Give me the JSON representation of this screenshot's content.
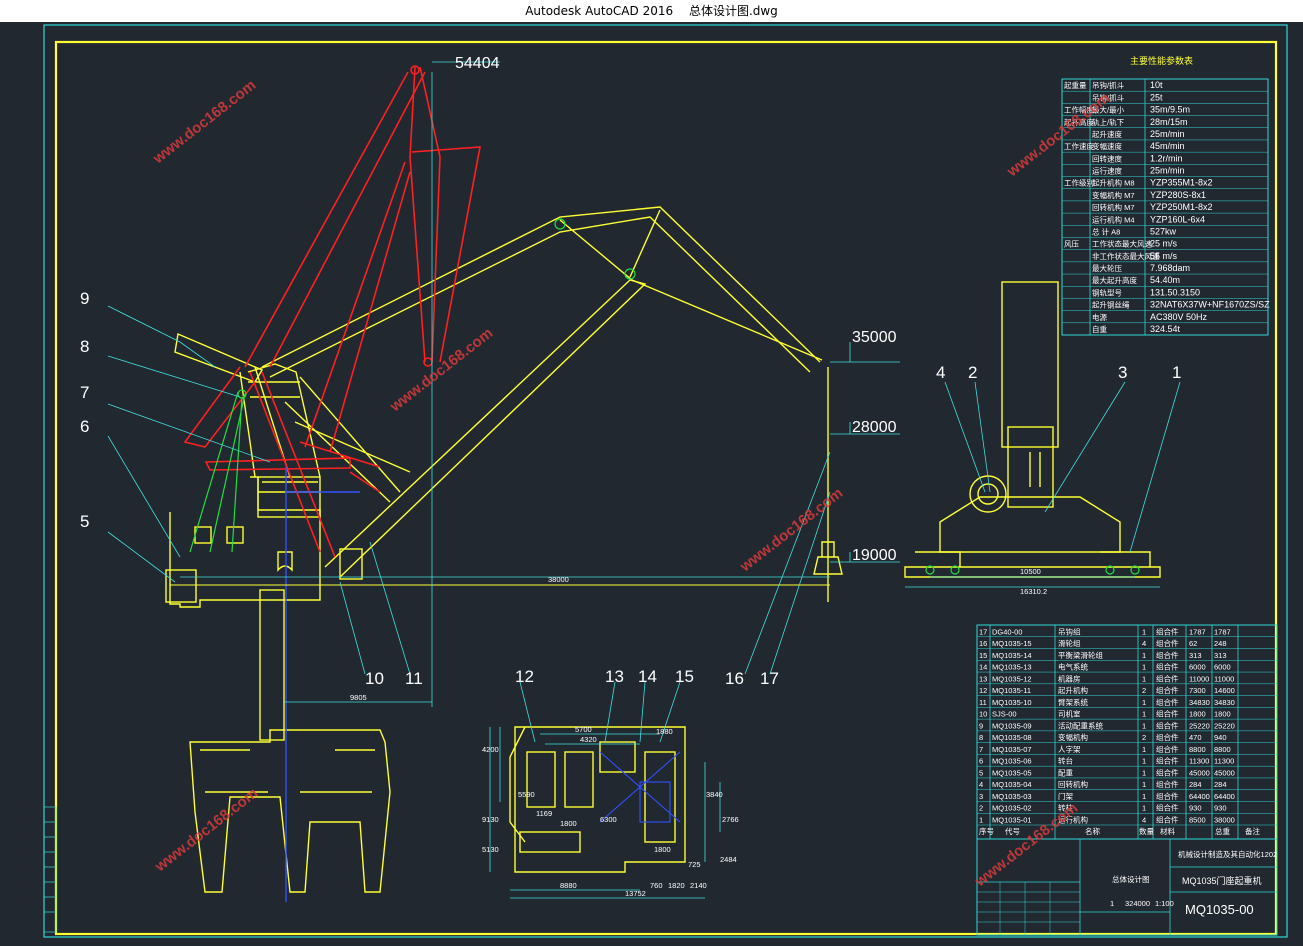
{
  "window": {
    "app": "Autodesk AutoCAD 2016",
    "file": "总体设计图.dwg"
  },
  "elevations": {
    "e1": "54404",
    "e2": "35000",
    "e3": "28000",
    "e4": "19000"
  },
  "part_labels": [
    "9",
    "8",
    "7",
    "6",
    "5",
    "10",
    "11",
    "12",
    "13",
    "14",
    "15",
    "16",
    "17",
    "4",
    "2",
    "3",
    "1"
  ],
  "dims": {
    "rail_span": "38000",
    "base_span": "9805",
    "front_a": "10500",
    "front_b": "16310.2",
    "plan_5700": "5700",
    "plan_4320": "4320",
    "plan_1880": "1880",
    "plan_8880": "8880",
    "plan_13752": "13752",
    "plan_760": "760",
    "plan_1820": "1820",
    "plan_2140": "2140",
    "plan_1800": "1800",
    "plan_1169": "1169",
    "plan_4200": "4200",
    "plan_9130": "9130",
    "plan_5130": "5130",
    "plan_3840": "3840",
    "plan_2766": "2766",
    "plan_2484": "2484",
    "plan_725": "725",
    "plan_5590": "5590",
    "plan_6300": "6300"
  },
  "perf_table": {
    "title": "主要性能参数表",
    "rows": [
      {
        "a": "起重量",
        "b": "吊钩/抓斗",
        "v": "10t"
      },
      {
        "a": "",
        "b": "吊钩/抓斗",
        "v": "25t"
      },
      {
        "a": "工作幅度",
        "b": "最大/最小",
        "v": "35m/9.5m"
      },
      {
        "a": "起升高度",
        "b": "轨上/轨下",
        "v": "28m/15m"
      },
      {
        "a": "",
        "b": "起升速度",
        "v": "25m/min"
      },
      {
        "a": "工作速度",
        "b": "变幅速度",
        "v": "45m/min"
      },
      {
        "a": "",
        "b": "回转速度",
        "v": "1.2r/min"
      },
      {
        "a": "",
        "b": "运行速度",
        "v": "25m/min"
      },
      {
        "a": "工作级别",
        "b": "起升机构 M8",
        "v": "YZP355M1-8x2"
      },
      {
        "a": "",
        "b": "变幅机构 M7",
        "v": "YZP280S-8x1"
      },
      {
        "a": "",
        "b": "回转机构 M7",
        "v": "YZP250M1-8x2"
      },
      {
        "a": "",
        "b": "运行机构 M4",
        "v": "YZP160L-6x4"
      },
      {
        "a": "",
        "b": "总  计 A8",
        "v": "527kw"
      },
      {
        "a": "风压",
        "b": "工作状态最大风速",
        "v": "25 m/s"
      },
      {
        "a": "",
        "b": "非工作状态最大风速",
        "v": "55 m/s"
      },
      {
        "a": "",
        "b": "最大轮压",
        "v": "7.968dam"
      },
      {
        "a": "",
        "b": "最大起升高度",
        "v": "54.40m"
      },
      {
        "a": "",
        "b": "钢轨型号",
        "v": "131.50.3150"
      },
      {
        "a": "",
        "b": "起升钢丝绳",
        "v": "32NAT6X37W+NF1670ZS/SZ"
      },
      {
        "a": "",
        "b": "电源",
        "v": "AC380V  50Hz"
      },
      {
        "a": "",
        "b": "自重",
        "v": "324.54t"
      }
    ]
  },
  "bom": {
    "rows": [
      {
        "no": "17",
        "code": "DG40-00",
        "name": "吊钩组",
        "qty": "1",
        "mat": "组合件",
        "w1": "1787",
        "w2": "1787"
      },
      {
        "no": "16",
        "code": "MQ1035-15",
        "name": "滑轮组",
        "qty": "4",
        "mat": "组合件",
        "w1": "62",
        "w2": "248"
      },
      {
        "no": "15",
        "code": "MQ1035-14",
        "name": "平衡梁滑轮组",
        "qty": "1",
        "mat": "组合件",
        "w1": "313",
        "w2": "313"
      },
      {
        "no": "14",
        "code": "MQ1035-13",
        "name": "电气系统",
        "qty": "1",
        "mat": "组合件",
        "w1": "6000",
        "w2": "6000"
      },
      {
        "no": "13",
        "code": "MQ1035-12",
        "name": "机器房",
        "qty": "1",
        "mat": "组合件",
        "w1": "11000",
        "w2": "11000"
      },
      {
        "no": "12",
        "code": "MQ1035-11",
        "name": "起升机构",
        "qty": "2",
        "mat": "组合件",
        "w1": "7300",
        "w2": "14600"
      },
      {
        "no": "11",
        "code": "MQ1035-10",
        "name": "臂架系统",
        "qty": "1",
        "mat": "组合件",
        "w1": "34830",
        "w2": "34830"
      },
      {
        "no": "10",
        "code": "SJS-00",
        "name": "司机室",
        "qty": "1",
        "mat": "组合件",
        "w1": "1800",
        "w2": "1800"
      },
      {
        "no": "9",
        "code": "MQ1035-09",
        "name": "活动配重系统",
        "qty": "1",
        "mat": "组合件",
        "w1": "25220",
        "w2": "25220"
      },
      {
        "no": "8",
        "code": "MQ1035-08",
        "name": "变幅机构",
        "qty": "2",
        "mat": "组合件",
        "w1": "470",
        "w2": "940"
      },
      {
        "no": "7",
        "code": "MQ1035-07",
        "name": "人字架",
        "qty": "1",
        "mat": "组合件",
        "w1": "8800",
        "w2": "8800"
      },
      {
        "no": "6",
        "code": "MQ1035-06",
        "name": "转台",
        "qty": "1",
        "mat": "组合件",
        "w1": "11300",
        "w2": "11300"
      },
      {
        "no": "5",
        "code": "MQ1035-05",
        "name": "配重",
        "qty": "1",
        "mat": "组合件",
        "w1": "45000",
        "w2": "45000"
      },
      {
        "no": "4",
        "code": "MQ1035-04",
        "name": "回转机构",
        "qty": "1",
        "mat": "组合件",
        "w1": "284",
        "w2": "284"
      },
      {
        "no": "3",
        "code": "MQ1035-03",
        "name": "门架",
        "qty": "1",
        "mat": "组合件",
        "w1": "64400",
        "w2": "64400"
      },
      {
        "no": "2",
        "code": "MQ1035-02",
        "name": "转柱",
        "qty": "1",
        "mat": "组合件",
        "w1": "930",
        "w2": "930"
      },
      {
        "no": "1",
        "code": "MQ1035-01",
        "name": "运行机构",
        "qty": "4",
        "mat": "组合件",
        "w1": "8500",
        "w2": "38000"
      }
    ],
    "header": {
      "no": "序号",
      "code": "代号",
      "name": "名称",
      "qty": "数量",
      "mat": "材料",
      "weight": "总重",
      "note": "备注"
    }
  },
  "title_block": {
    "assembly": "总体设计图",
    "drawing_name": "MQ1035门座起重机",
    "drawing_no": "MQ1035-00",
    "company": "机械设计制造及其自动化1202",
    "weight": "324000",
    "scale": "1:100",
    "sheet": "1"
  },
  "watermark": "www.doc168.com",
  "colors": {
    "background": "#212830",
    "frame": "#ffff33",
    "luffed": "#ff2020",
    "table": "#30d8d8",
    "dim": "#40e0e0"
  }
}
